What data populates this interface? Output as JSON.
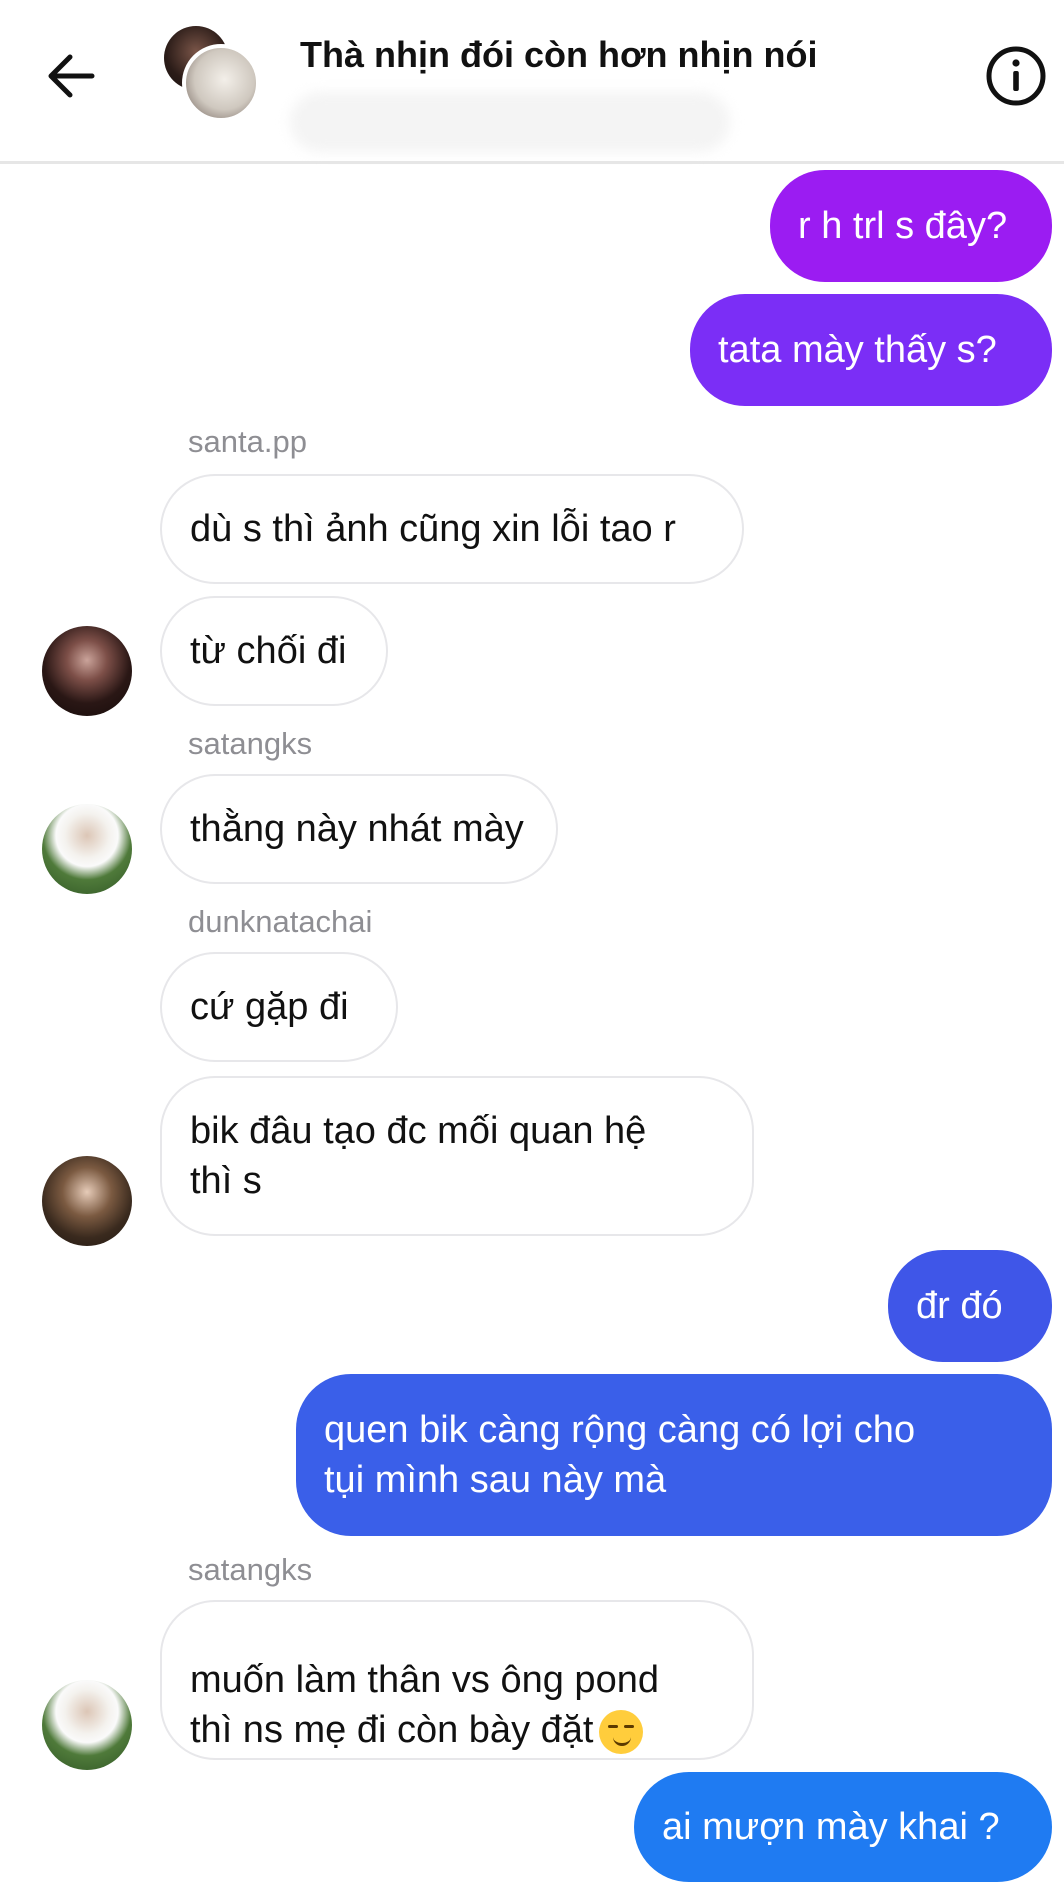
{
  "header": {
    "title": "Thà nhịn đói còn hơn nhịn nói",
    "back_icon": "arrow-left-icon",
    "info_icon": "info-icon"
  },
  "colors": {
    "outgoing_purple": "#9b1cf2",
    "outgoing_indigo": "#7b2ef6",
    "outgoing_blue": "#3f56e8",
    "outgoing_sky": "#1f7bf2",
    "incoming_bg": "#ffffff",
    "incoming_border": "#e7e7ea"
  },
  "messages": [
    {
      "id": "m1",
      "direction": "out",
      "text": "r h trl s đây?"
    },
    {
      "id": "m2",
      "direction": "out",
      "text": "tata mày thấy s?"
    },
    {
      "id": "m3",
      "direction": "in",
      "sender": "santa.pp",
      "text": "dù s thì ảnh cũng xin lỗi tao r"
    },
    {
      "id": "m4",
      "direction": "in",
      "text": "từ chối đi"
    },
    {
      "id": "m5",
      "direction": "in",
      "sender": "satangks",
      "text": "thằng này nhát mày"
    },
    {
      "id": "m6",
      "direction": "in",
      "sender": "dunknatachai",
      "text": "cứ gặp đi"
    },
    {
      "id": "m7",
      "direction": "in",
      "text": "bik đâu tạo đc mối quan hệ\nthì s"
    },
    {
      "id": "m8",
      "direction": "out",
      "text": "đr đó"
    },
    {
      "id": "m9",
      "direction": "out",
      "text": "quen bik càng rộng càng có lợi cho\ntụi mình sau này mà"
    },
    {
      "id": "m10",
      "direction": "in",
      "sender": "satangks",
      "text": "muốn làm thân vs ông pond\nthì ns mẹ đi còn bày đặt",
      "emoji": "smirking-face-emoji"
    },
    {
      "id": "m11",
      "direction": "out",
      "text": "ai mượn mày khai ?"
    }
  ]
}
